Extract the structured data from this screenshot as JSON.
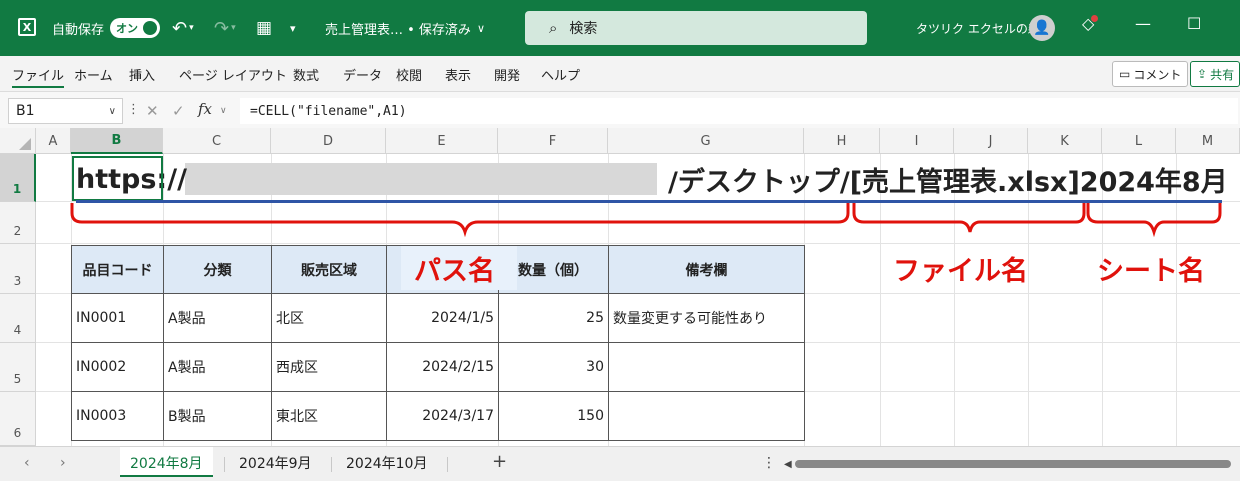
{
  "titlebar": {
    "autosave_label": "自動保存",
    "autosave_state": "オン",
    "doc_title": "売上管理表… • 保存済み",
    "search_placeholder": "検索",
    "user_name": "タツリク エクセルの森",
    "undo_icon": "undo-icon",
    "redo_icon": "redo-icon"
  },
  "ribbon": {
    "tabs": [
      "ファイル",
      "ホーム",
      "挿入",
      "ページ レイアウト",
      "数式",
      "データ",
      "校閲",
      "表示",
      "開発",
      "ヘルプ"
    ],
    "comment_label": "コメント",
    "share_label": "共有"
  },
  "formula_bar": {
    "name_box": "B1",
    "fx": "fx",
    "formula": "=CELL(\"filename\",A1)"
  },
  "grid": {
    "columns": [
      "A",
      "B",
      "C",
      "D",
      "E",
      "F",
      "G",
      "H",
      "I",
      "J",
      "K",
      "L",
      "M"
    ],
    "rows": [
      "1",
      "2",
      "3",
      "4",
      "5",
      "6"
    ],
    "selected_column": "B",
    "selected_row": "1"
  },
  "cell_b1": {
    "prefix": "https:/",
    "slash": "/",
    "suffix": "/デスクトップ/[売上管理表.xlsx]2024年8月"
  },
  "table": {
    "headers": [
      "品目コード",
      "分類",
      "販売区域",
      "",
      "数量（個）",
      "備考欄"
    ],
    "rows": [
      [
        "IN0001",
        "A製品",
        "北区",
        "2024/1/5",
        "25",
        "数量変更する可能性あり"
      ],
      [
        "IN0002",
        "A製品",
        "西成区",
        "2024/2/15",
        "30",
        ""
      ],
      [
        "IN0003",
        "B製品",
        "東北区",
        "2024/3/17",
        "150",
        ""
      ]
    ]
  },
  "annotations": {
    "path_label": "パス名",
    "file_label": "ファイル名",
    "sheet_label": "シート名",
    "color": "#e0120c"
  },
  "sheets": {
    "tabs": [
      "2024年8月",
      "2024年9月",
      "2024年10月"
    ],
    "active": "2024年8月",
    "add": "+"
  },
  "colors": {
    "excel_green": "#117a42",
    "underline_blue": "#2f55a6",
    "header_fill": "#dde9f6"
  }
}
